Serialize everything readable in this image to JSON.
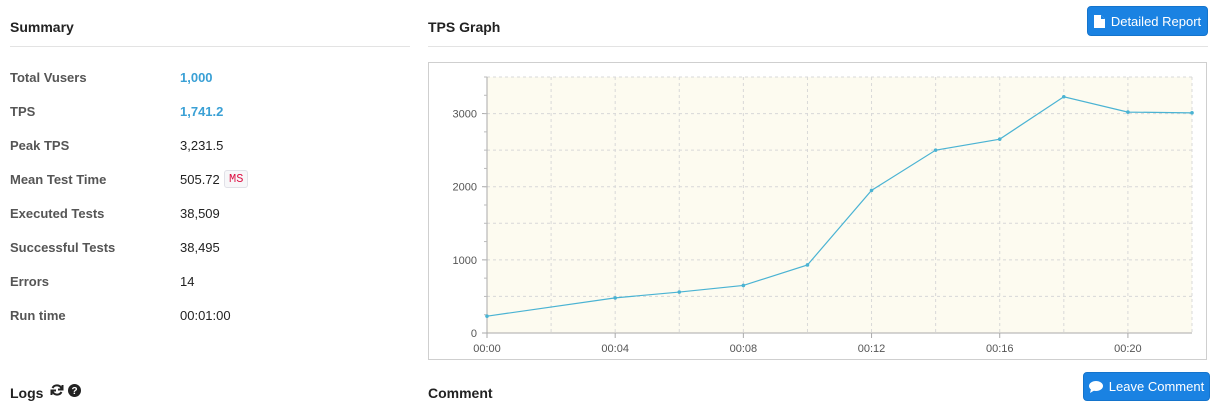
{
  "summary": {
    "title": "Summary",
    "stats": [
      {
        "label": "Total Vusers",
        "value": "1,000"
      },
      {
        "label": "TPS",
        "value": "1,741.2"
      },
      {
        "label": "Peak TPS",
        "value": "3,231.5"
      },
      {
        "label": "Mean Test Time",
        "value": "505.72",
        "unit": "MS"
      },
      {
        "label": "Executed Tests",
        "value": "38,509"
      },
      {
        "label": "Successful Tests",
        "value": "38,495"
      },
      {
        "label": "Errors",
        "value": "14"
      },
      {
        "label": "Run time",
        "value": "00:01:00"
      }
    ]
  },
  "graph": {
    "title": "TPS Graph",
    "report_button": "Detailed Report"
  },
  "logs": {
    "title": "Logs"
  },
  "comment": {
    "title": "Comment",
    "button": "Leave Comment"
  },
  "colors": {
    "accent": "#3aa0d5",
    "button": "#1a82e2",
    "plot_background": "#fdfbf0",
    "line": "#4ab3d3"
  },
  "chart_data": {
    "type": "line",
    "title": "",
    "xlabel": "",
    "ylabel": "",
    "x_ticks": [
      "00:00",
      "00:04",
      "00:08",
      "00:12",
      "00:16",
      "00:20"
    ],
    "y_ticks": [
      0,
      1000,
      2000,
      3000
    ],
    "xlim_seconds": [
      0,
      22
    ],
    "ylim": [
      0,
      3500
    ],
    "grid": true,
    "series": [
      {
        "x_seconds": [
          0,
          4,
          6,
          8,
          10,
          12,
          14,
          16,
          18,
          20,
          22
        ],
        "values": [
          230,
          480,
          560,
          650,
          930,
          1950,
          2500,
          2650,
          3230,
          3020,
          3010
        ]
      }
    ]
  }
}
